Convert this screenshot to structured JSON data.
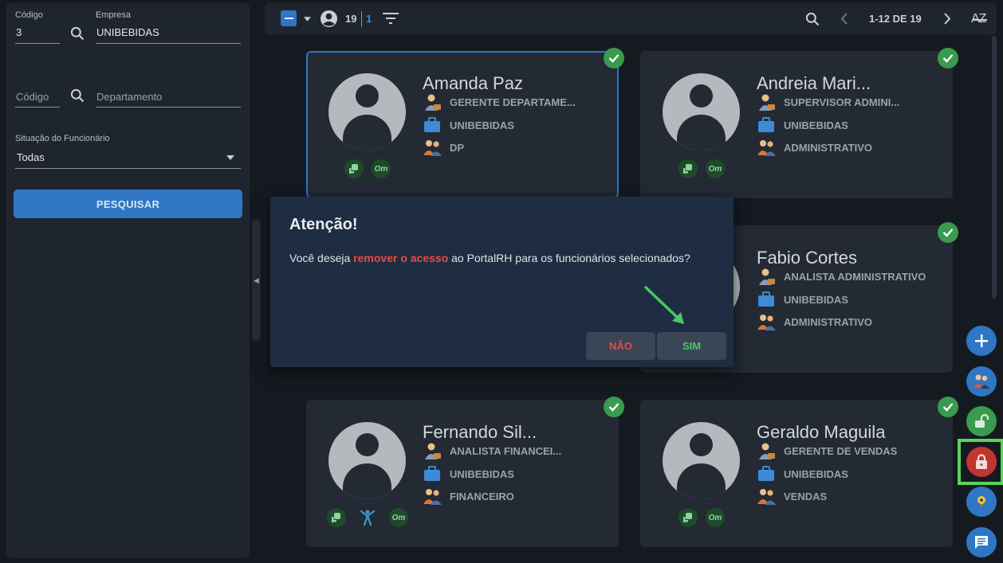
{
  "filters": {
    "codigo_label": "Código",
    "codigo_value": "3",
    "empresa_label": "Empresa",
    "empresa_value": "UNIBEBIDAS",
    "dept_codigo_placeholder": "Código",
    "departamento_placeholder": "Departamento",
    "situacao_label": "Situação do Funcionário",
    "situacao_value": "Todas",
    "search_button": "PESQUISAR"
  },
  "toolbar": {
    "count_total": "19",
    "count_selected": "1",
    "pagination": "1-12 DE 19",
    "sort_label": "AZ"
  },
  "cards": [
    {
      "name": "Amanda Paz",
      "cargo": "GERENTE DEPARTAME...",
      "empresa": "UNIBEBIDAS",
      "departamento": "DP",
      "badges": [
        "portal",
        "om"
      ],
      "selected": true
    },
    {
      "name": "Andreia Mari...",
      "cargo": "SUPERVISOR ADMINI...",
      "empresa": "UNIBEBIDAS",
      "departamento": "ADMINISTRATIVO",
      "badges": [
        "portal",
        "om"
      ],
      "selected": false
    },
    {
      "name": "Fabio Cortes",
      "cargo": "ANALISTA ADMINISTRATIVO",
      "empresa": "UNIBEBIDAS",
      "departamento": "ADMINISTRATIVO",
      "badges": [],
      "selected": false
    },
    {
      "name": "Fernando Sil...",
      "cargo": "ANALISTA FINANCEI...",
      "empresa": "UNIBEBIDAS",
      "departamento": "FINANCEIRO",
      "badges": [
        "portal",
        "fitness",
        "om"
      ],
      "selected": false
    },
    {
      "name": "Geraldo Maguila",
      "cargo": "GERENTE DE VENDAS",
      "empresa": "UNIBEBIDAS",
      "departamento": "VENDAS",
      "badges": [
        "portal",
        "om"
      ],
      "selected": false
    }
  ],
  "badge_text": {
    "om": "Om"
  },
  "modal": {
    "title": "Atenção!",
    "msg_before": "Você deseja ",
    "msg_highlight": "remover o acesso",
    "msg_after": " ao PortalRH para os funcionários selecionados?",
    "no_button": "NÃO",
    "yes_button": "SIM"
  },
  "colors": {
    "accent": "#2f76c5",
    "danger": "#e84a4a",
    "success": "#4cc765",
    "highlight_box": "#55d65c"
  },
  "icons": [
    "search-icon",
    "filter-icon",
    "chevron-left-icon",
    "chevron-right-icon",
    "sort-az-icon",
    "avatar-icon",
    "check-icon",
    "plus-icon",
    "lock-icon",
    "unlock-icon",
    "chat-icon"
  ]
}
